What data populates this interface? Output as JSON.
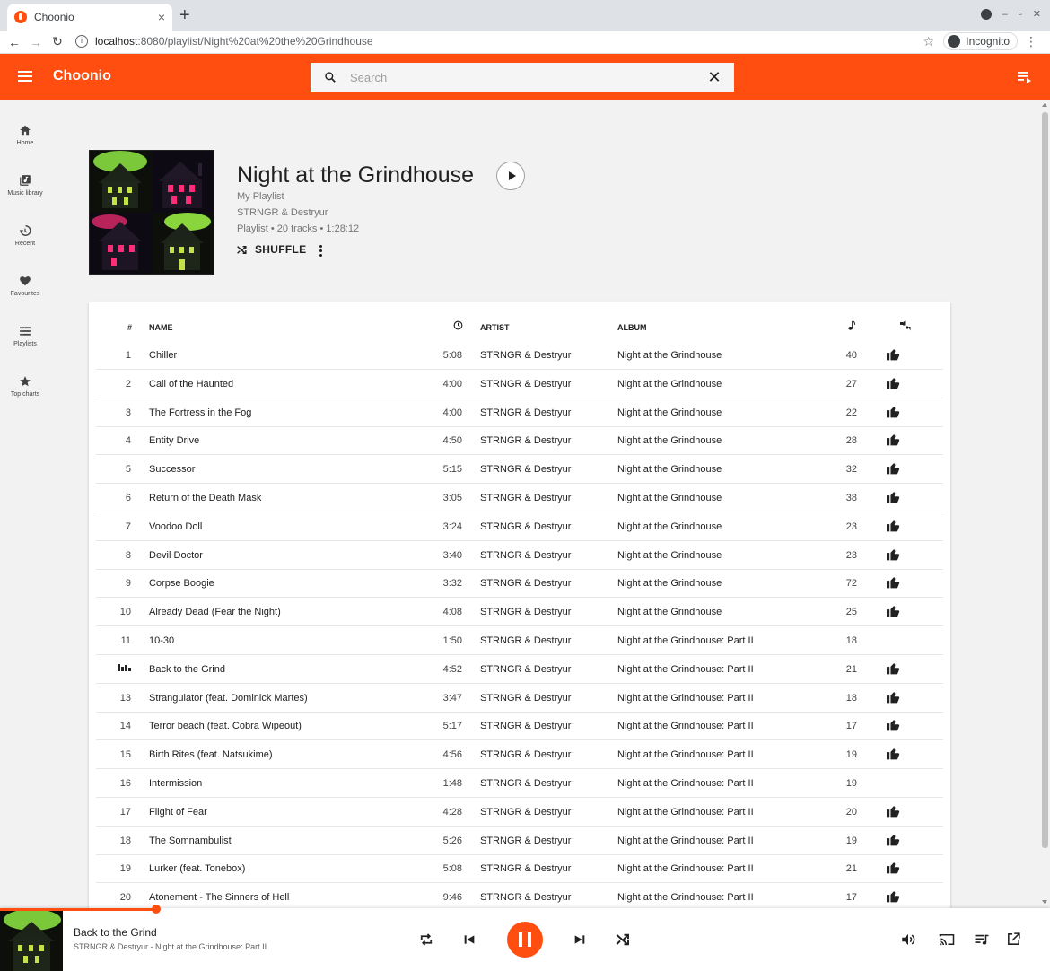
{
  "browser": {
    "tab_title": "Choonio",
    "tab_close": "×",
    "new_tab": "+",
    "url_host": "localhost",
    "url_rest": ":8080/playlist/Night%20at%20the%20Grindhouse",
    "incognito_label": "Incognito"
  },
  "app": {
    "brand": "Choonio",
    "search_placeholder": "Search",
    "accent_color": "#ff4e0f"
  },
  "sidenav": [
    {
      "label": "Home",
      "icon": "home-icon"
    },
    {
      "label": "Music library",
      "icon": "library-icon"
    },
    {
      "label": "Recent",
      "icon": "history-icon"
    },
    {
      "label": "Favourites",
      "icon": "heart-icon"
    },
    {
      "label": "Playlists",
      "icon": "list-icon"
    },
    {
      "label": "Top charts",
      "icon": "star-icon"
    }
  ],
  "playlist": {
    "title": "Night at the Grindhouse",
    "owner": "My Playlist",
    "artists": "STRNGR & Destryur",
    "summary": "Playlist • 20 tracks • 1:28:12",
    "shuffle_label": "SHUFFLE"
  },
  "table": {
    "headers": {
      "num": "#",
      "name": "NAME",
      "artist": "ARTIST",
      "album": "ALBUM"
    },
    "rows": [
      {
        "num": "1",
        "name": "Chiller",
        "duration": "5:08",
        "artist": "STRNGR & Destryur",
        "album": "Night at the Grindhouse",
        "plays": "40",
        "liked": true
      },
      {
        "num": "2",
        "name": "Call of the Haunted",
        "duration": "4:00",
        "artist": "STRNGR & Destryur",
        "album": "Night at the Grindhouse",
        "plays": "27",
        "liked": true
      },
      {
        "num": "3",
        "name": "The Fortress in the Fog",
        "duration": "4:00",
        "artist": "STRNGR & Destryur",
        "album": "Night at the Grindhouse",
        "plays": "22",
        "liked": true
      },
      {
        "num": "4",
        "name": "Entity Drive",
        "duration": "4:50",
        "artist": "STRNGR & Destryur",
        "album": "Night at the Grindhouse",
        "plays": "28",
        "liked": true
      },
      {
        "num": "5",
        "name": "Successor",
        "duration": "5:15",
        "artist": "STRNGR & Destryur",
        "album": "Night at the Grindhouse",
        "plays": "32",
        "liked": true
      },
      {
        "num": "6",
        "name": "Return of the Death Mask",
        "duration": "3:05",
        "artist": "STRNGR & Destryur",
        "album": "Night at the Grindhouse",
        "plays": "38",
        "liked": true
      },
      {
        "num": "7",
        "name": "Voodoo Doll",
        "duration": "3:24",
        "artist": "STRNGR & Destryur",
        "album": "Night at the Grindhouse",
        "plays": "23",
        "liked": true
      },
      {
        "num": "8",
        "name": "Devil Doctor",
        "duration": "3:40",
        "artist": "STRNGR & Destryur",
        "album": "Night at the Grindhouse",
        "plays": "23",
        "liked": true
      },
      {
        "num": "9",
        "name": "Corpse Boogie",
        "duration": "3:32",
        "artist": "STRNGR & Destryur",
        "album": "Night at the Grindhouse",
        "plays": "72",
        "liked": true
      },
      {
        "num": "10",
        "name": "Already Dead (Fear the Night)",
        "duration": "4:08",
        "artist": "STRNGR & Destryur",
        "album": "Night at the Grindhouse",
        "plays": "25",
        "liked": true
      },
      {
        "num": "11",
        "name": "10-30",
        "duration": "1:50",
        "artist": "STRNGR & Destryur",
        "album": "Night at the Grindhouse: Part II",
        "plays": "18",
        "liked": false
      },
      {
        "num": "",
        "name": "Back to the Grind",
        "duration": "4:52",
        "artist": "STRNGR & Destryur",
        "album": "Night at the Grindhouse: Part II",
        "plays": "21",
        "liked": true,
        "playing": true
      },
      {
        "num": "13",
        "name": "Strangulator (feat. Dominick Martes)",
        "duration": "3:47",
        "artist": "STRNGR & Destryur",
        "album": "Night at the Grindhouse: Part II",
        "plays": "18",
        "liked": true
      },
      {
        "num": "14",
        "name": "Terror beach (feat. Cobra Wipeout)",
        "duration": "5:17",
        "artist": "STRNGR & Destryur",
        "album": "Night at the Grindhouse: Part II",
        "plays": "17",
        "liked": true
      },
      {
        "num": "15",
        "name": "Birth Rites (feat. Natsukime)",
        "duration": "4:56",
        "artist": "STRNGR & Destryur",
        "album": "Night at the Grindhouse: Part II",
        "plays": "19",
        "liked": true
      },
      {
        "num": "16",
        "name": "Intermission",
        "duration": "1:48",
        "artist": "STRNGR & Destryur",
        "album": "Night at the Grindhouse: Part II",
        "plays": "19",
        "liked": false
      },
      {
        "num": "17",
        "name": "Flight of Fear",
        "duration": "4:28",
        "artist": "STRNGR & Destryur",
        "album": "Night at the Grindhouse: Part II",
        "plays": "20",
        "liked": true
      },
      {
        "num": "18",
        "name": "The Somnambulist",
        "duration": "5:26",
        "artist": "STRNGR & Destryur",
        "album": "Night at the Grindhouse: Part II",
        "plays": "19",
        "liked": true
      },
      {
        "num": "19",
        "name": "Lurker (feat. Tonebox)",
        "duration": "5:08",
        "artist": "STRNGR & Destryur",
        "album": "Night at the Grindhouse: Part II",
        "plays": "21",
        "liked": true
      },
      {
        "num": "20",
        "name": "Atonement - The Sinners of Hell",
        "duration": "9:46",
        "artist": "STRNGR & Destryur",
        "album": "Night at the Grindhouse: Part II",
        "plays": "17",
        "liked": true
      }
    ]
  },
  "player": {
    "title": "Back to the Grind",
    "subtitle": "STRNGR & Destryur - Night at the Grindhouse: Part II",
    "progress_fraction": 0.149,
    "state": "playing"
  }
}
